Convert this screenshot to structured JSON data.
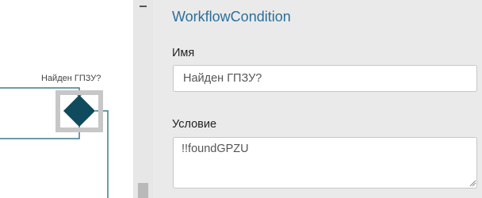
{
  "canvas": {
    "node_label": "Найден ГПЗУ?",
    "node_icon": "diamond-condition-icon",
    "node_color": "#0f4b5c",
    "line_color": "#3a7d8c"
  },
  "panel": {
    "title": "WorkflowCondition",
    "name_label": "Имя",
    "name_value": "Найден ГПЗУ?",
    "condition_label": "Условие",
    "condition_value": "!!foundGPZU"
  },
  "colors": {
    "title": "#2b6f9a",
    "panel_bg": "#eaeaea",
    "splitter_bg": "#e7e7e7"
  }
}
